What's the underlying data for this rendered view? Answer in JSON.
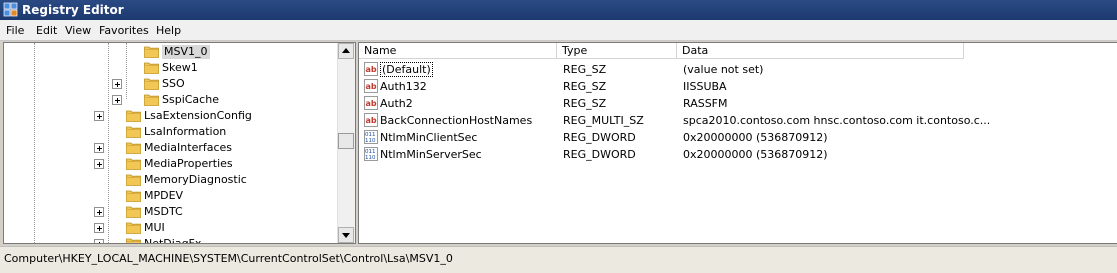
{
  "window": {
    "title": "Registry Editor"
  },
  "menu": [
    "File",
    "Edit",
    "View",
    "Favorites",
    "Help"
  ],
  "tree": {
    "items": [
      {
        "label": "MSV1_0",
        "expandable": false,
        "selected": true
      },
      {
        "label": "Skew1",
        "expandable": false
      },
      {
        "label": "SSO",
        "expandable": true
      },
      {
        "label": "SspiCache",
        "expandable": true
      },
      {
        "label": "LsaExtensionConfig",
        "expandable": true
      },
      {
        "label": "LsaInformation",
        "expandable": false
      },
      {
        "label": "MediaInterfaces",
        "expandable": true
      },
      {
        "label": "MediaProperties",
        "expandable": true
      },
      {
        "label": "MemoryDiagnostic",
        "expandable": false
      },
      {
        "label": "MPDEV",
        "expandable": false
      },
      {
        "label": "MSDTC",
        "expandable": true
      },
      {
        "label": "MUI",
        "expandable": true
      },
      {
        "label": "NetDiagFx",
        "expandable": true
      }
    ]
  },
  "list": {
    "columns": [
      "Name",
      "Type",
      "Data"
    ],
    "rows": [
      {
        "icon": "string-value-icon",
        "name": "(Default)",
        "type": "REG_SZ",
        "data": "(value not set)"
      },
      {
        "icon": "string-value-icon",
        "name": "Auth132",
        "type": "REG_SZ",
        "data": "IISSUBA"
      },
      {
        "icon": "string-value-icon",
        "name": "Auth2",
        "type": "REG_SZ",
        "data": "RASSFM"
      },
      {
        "icon": "string-value-icon",
        "name": "BackConnectionHostNames",
        "type": "REG_MULTI_SZ",
        "data": "spca2010.contoso.com hnsc.contoso.com it.contoso.c..."
      },
      {
        "icon": "binary-value-icon",
        "name": "NtlmMinClientSec",
        "type": "REG_DWORD",
        "data": "0x20000000 (536870912)"
      },
      {
        "icon": "binary-value-icon",
        "name": "NtlmMinServerSec",
        "type": "REG_DWORD",
        "data": "0x20000000 (536870912)"
      }
    ]
  },
  "status": {
    "path": "Computer\\HKEY_LOCAL_MACHINE\\SYSTEM\\CurrentControlSet\\Control\\Lsa\\MSV1_0"
  },
  "colors": {
    "title_bar": "#1d3a70",
    "folder": "#f3c755",
    "selection": "#d9d9d9"
  }
}
